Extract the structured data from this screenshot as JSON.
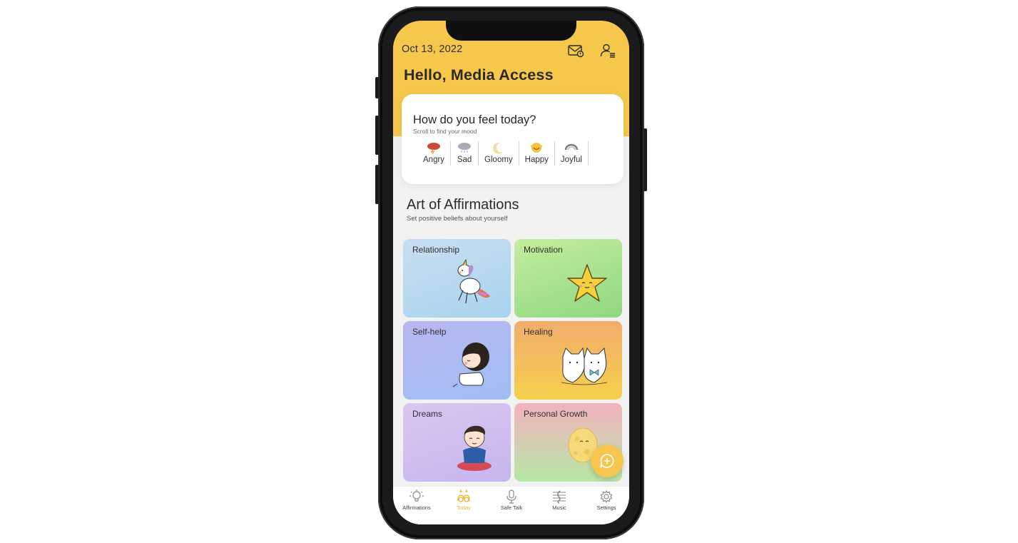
{
  "header": {
    "date": "Oct 13, 2022",
    "greeting": "Hello, Media Access",
    "icons": [
      "mail-icon",
      "profile-list-icon"
    ]
  },
  "mood_card": {
    "title": "How do you feel today?",
    "subtitle": "Scroll to find your mood",
    "moods": [
      {
        "label": "Angry",
        "icon": "storm-cloud-icon"
      },
      {
        "label": "Sad",
        "icon": "rain-cloud-icon"
      },
      {
        "label": "Gloomy",
        "icon": "moon-icon"
      },
      {
        "label": "Happy",
        "icon": "happy-face-icon"
      },
      {
        "label": "Joyful",
        "icon": "rainbow-icon"
      }
    ]
  },
  "affirmations": {
    "title": "Art of Affirmations",
    "subtitle": "Set positive beliefs about yourself",
    "categories": [
      {
        "label": "Relationship",
        "illustration": "unicorn"
      },
      {
        "label": "Motivation",
        "illustration": "star"
      },
      {
        "label": "Self-help",
        "illustration": "girl"
      },
      {
        "label": "Healing",
        "illustration": "cats"
      },
      {
        "label": "Dreams",
        "illustration": "boy"
      },
      {
        "label": "Personal Growth",
        "illustration": "moon"
      }
    ]
  },
  "tabbar": {
    "tabs": [
      {
        "label": "Affirmations",
        "icon": "bulb-icon",
        "active": false
      },
      {
        "label": "Today",
        "icon": "today-icon",
        "active": true
      },
      {
        "label": "Safe Talk",
        "icon": "microphone-icon",
        "active": false
      },
      {
        "label": "Music",
        "icon": "music-icon",
        "active": false
      },
      {
        "label": "Settings",
        "icon": "settings-icon",
        "active": false
      }
    ]
  },
  "colors": {
    "brand_yellow": "#f5c84c",
    "active_tab": "#e9b52f"
  }
}
